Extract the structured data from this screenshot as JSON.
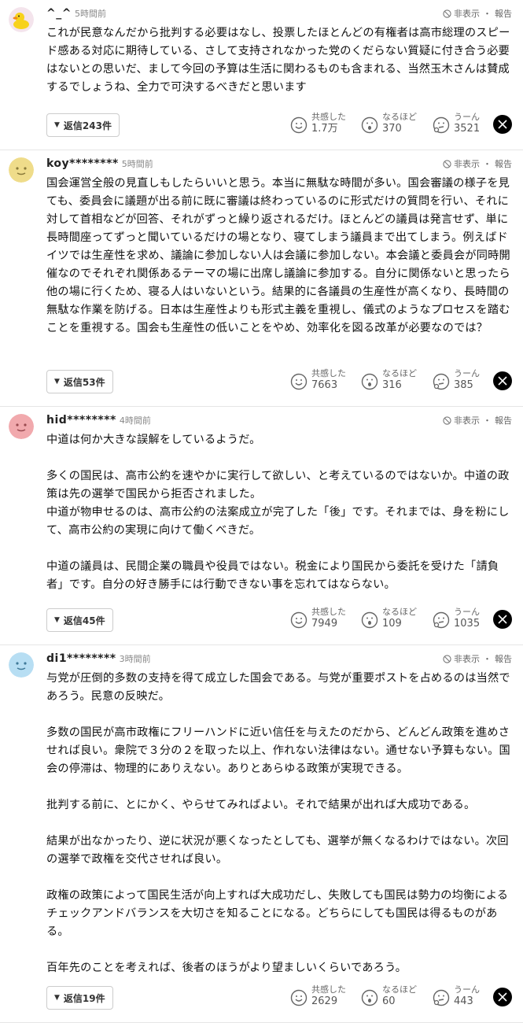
{
  "menu": {
    "hide": "非表示",
    "report": "報告",
    "separator": "・"
  },
  "reactions": {
    "empathy": "共感した",
    "insight": "なるほど",
    "hmm": "うーん"
  },
  "comments": [
    {
      "username": "^_^",
      "time": "5時間前",
      "avatar": "duck-avatar",
      "body": "これが民意なんだから批判する必要はなし、投票したほとんどの有権者は高市総理のスピード感ある対応に期待している、さして支持されなかった党のくだらない質疑に付き合う必要はないとの思いだ、まして今回の予算は生活に関わるものも含まれる、当然玉木さんは賛成するでしょうね、全力で可決するべきだと思います",
      "reply": "返信243件",
      "empathy": "1.7万",
      "insight": "370",
      "hmm": "3521"
    },
    {
      "username": "koy********",
      "time": "5時間前",
      "avatar": "yellow-face-avatar",
      "body": "国会運営全般の見直しもしたらいいと思う。本当に無駄な時間が多い。国会審議の様子を見ても、委員会に議題が出る前に既に審議は終わっているのに形式だけの質問を行い、それに対して首相などが回答、それがずっと繰り返されるだけ。ほとんどの議員は発言せず、単に長時間座ってずっと聞いているだけの場となり、寝てしまう議員まで出てしまう。例えばドイツでは生産性を求め、議論に参加しない人は会議に参加しない。本会議と委員会が同時開催なのでそれぞれ関係あるテーマの場に出席し議論に参加する。自分に関係ないと思ったら他の場に行くため、寝る人はいないという。結果的に各議員の生産性が高くなり、長時間の無駄な作業を防げる。日本は生産性よりも形式主義を重視し、儀式のようなプロセスを踏むことを重視する。国会も生産性の低いことをやめ、効率化を図る改革が必要なのでは？",
      "reply": "返信53件",
      "empathy": "7663",
      "insight": "316",
      "hmm": "385"
    },
    {
      "username": "hid********",
      "time": "4時間前",
      "avatar": "pink-face-avatar",
      "body": "中道は何か大きな誤解をしているようだ。\n\n多くの国民は、高市公約を速やかに実行して欲しい、と考えているのではないか。中道の政策は先の選挙で国民から拒否されました。\n中道が物申せるのは、高市公約の法案成立が完了した「後」です。それまでは、身を粉にして、高市公約の実現に向けて働くべきだ。\n\n中道の議員は、民間企業の職員や役員ではない。税金により国民から委託を受けた「請負者」です。自分の好き勝手には行動できない事を忘れてはならない。",
      "reply": "返信45件",
      "empathy": "7949",
      "insight": "109",
      "hmm": "1035"
    },
    {
      "username": "di1********",
      "time": "3時間前",
      "avatar": "blue-face-avatar",
      "body": "与党が圧倒的多数の支持を得て成立した国会である。与党が重要ポストを占めるのは当然であろう。民意の反映だ。\n\n多数の国民が高市政権にフリーハンドに近い信任を与えたのだから、どんどん政策を進めさせれば良い。衆院で３分の２を取った以上、作れない法律はない。通せない予算もない。国会の停滞は、物理的にありえない。ありとあらゆる政策が実現できる。\n\n批判する前に、とにかく、やらせてみればよい。それで結果が出れば大成功である。\n\n結果が出なかったり、逆に状況が悪くなったとしても、選挙が無くなるわけではない。次回の選挙で政権を交代させれば良い。\n\n政権の政策によって国民生活が向上すれば大成功だし、失敗しても国民は勢力の均衡によるチェックアンドバランスを大切さを知ることになる。どちらにしても国民は得るものがある。\n\n百年先のことを考えれば、後者のほうがより望ましいくらいであろう。",
      "reply": "返信19件",
      "empathy": "2629",
      "insight": "60",
      "hmm": "443"
    }
  ]
}
